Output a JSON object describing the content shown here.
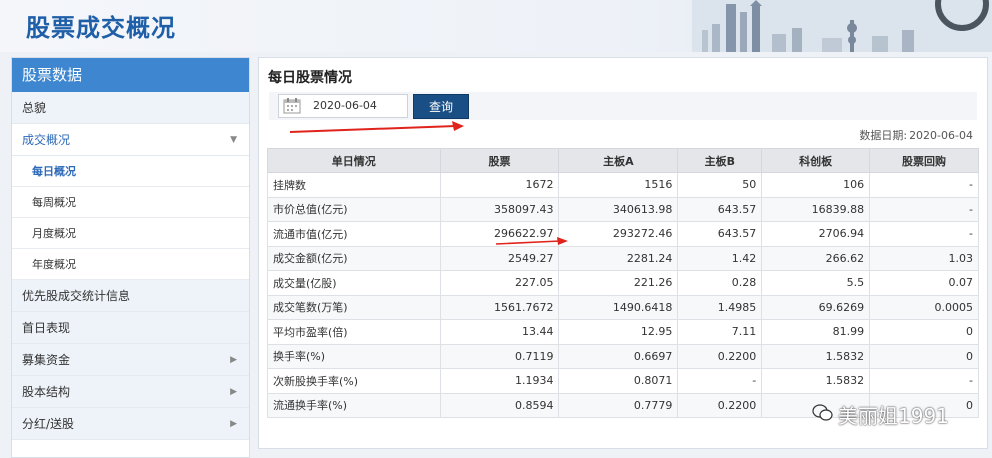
{
  "header": {
    "title": "股票成交概况"
  },
  "sidebar": {
    "heading": "股票数据",
    "items": [
      {
        "label": "总貌"
      },
      {
        "label": "成交概况"
      },
      {
        "label": "每日概况"
      },
      {
        "label": "每周概况"
      },
      {
        "label": "月度概况"
      },
      {
        "label": "年度概况"
      },
      {
        "label": "优先股成交统计信息"
      },
      {
        "label": "首日表现"
      },
      {
        "label": "募集资金"
      },
      {
        "label": "股本结构"
      },
      {
        "label": "分红/送股"
      }
    ]
  },
  "main": {
    "title": "每日股票情况",
    "date_value": "2020-06-04",
    "query_label": "查询",
    "data_date_label": "数据日期:",
    "data_date_value": "2020-06-04"
  },
  "table": {
    "headers": [
      "单日情况",
      "股票",
      "主板A",
      "主板B",
      "科创板",
      "股票回购"
    ],
    "rows": [
      [
        "挂牌数",
        "1672",
        "1516",
        "50",
        "106",
        "-"
      ],
      [
        "市价总值(亿元)",
        "358097.43",
        "340613.98",
        "643.57",
        "16839.88",
        "-"
      ],
      [
        "流通市值(亿元)",
        "296622.97",
        "293272.46",
        "643.57",
        "2706.94",
        "-"
      ],
      [
        "成交金额(亿元)",
        "2549.27",
        "2281.24",
        "1.42",
        "266.62",
        "1.03"
      ],
      [
        "成交量(亿股)",
        "227.05",
        "221.26",
        "0.28",
        "5.5",
        "0.07"
      ],
      [
        "成交笔数(万笔)",
        "1561.7672",
        "1490.6418",
        "1.4985",
        "69.6269",
        "0.0005"
      ],
      [
        "平均市盈率(倍)",
        "13.44",
        "12.95",
        "7.11",
        "81.99",
        "0"
      ],
      [
        "换手率(%)",
        "0.7119",
        "0.6697",
        "0.2200",
        "1.5832",
        "0"
      ],
      [
        "次新股换手率(%)",
        "1.1934",
        "0.8071",
        "-",
        "1.5832",
        "-"
      ],
      [
        "流通换手率(%)",
        "0.8594",
        "0.7779",
        "0.2200",
        "",
        "0"
      ]
    ]
  },
  "watermark": {
    "text": "美丽姐1991"
  },
  "colors": {
    "accent": "#3e86cf",
    "button": "#1a4f86",
    "arrow": "#e0231b"
  }
}
